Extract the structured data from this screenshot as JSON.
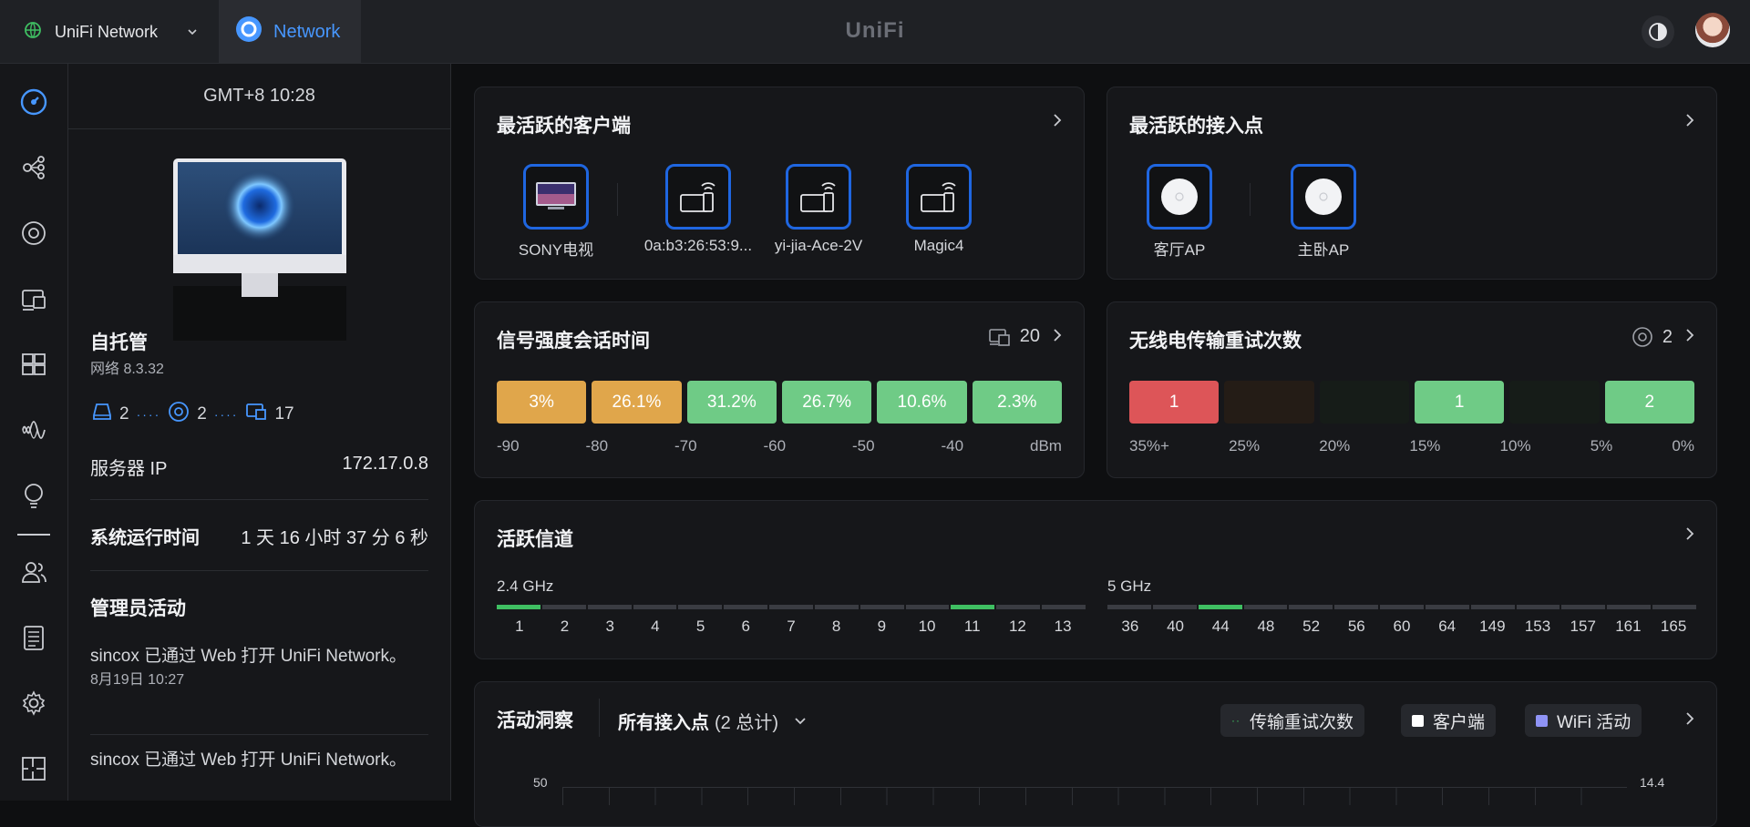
{
  "topbar": {
    "app_name": "UniFi Network",
    "active_tab": "Network",
    "brand": "UniFi"
  },
  "sidebar": {
    "time": "GMT+8 10:28",
    "title": "自托管",
    "version": "网络 8.3.32",
    "counts": {
      "gateways": "2",
      "aps": "2",
      "clients": "17"
    },
    "server_ip_label": "服务器 IP",
    "server_ip": "172.17.0.8",
    "uptime_label": "系统运行时间",
    "uptime": "1 天 16 小时 37 分 6 秒",
    "admin_title": "管理员活动",
    "activities": [
      {
        "text": "sincox 已通过 Web 打开 UniFi Network。",
        "time": "8月19日 10:27"
      },
      {
        "text": "sincox 已通过 Web 打开 UniFi Network。",
        "time": ""
      }
    ]
  },
  "top_clients": {
    "title": "最活跃的客户端",
    "items": [
      {
        "label": "SONY电视",
        "icon": "tv-icon"
      },
      {
        "label": "0a:b3:26:53:9...",
        "icon": "wifi-device-icon"
      },
      {
        "label": "yi-jia-Ace-2V",
        "icon": "wifi-device-icon"
      },
      {
        "label": "Magic4",
        "icon": "wifi-device-icon"
      }
    ]
  },
  "top_aps": {
    "title": "最活跃的接入点",
    "items": [
      {
        "label": "客厅AP",
        "icon": "access-point-icon"
      },
      {
        "label": "主卧AP",
        "icon": "access-point-icon"
      }
    ]
  },
  "signal": {
    "title": "信号强度会话时间",
    "count": "20",
    "segments": [
      {
        "value": "3%",
        "color": "#e0a64b"
      },
      {
        "value": "26.1%",
        "color": "#e0a64b"
      },
      {
        "value": "31.2%",
        "color": "#6fcb86"
      },
      {
        "value": "26.7%",
        "color": "#6fcb86"
      },
      {
        "value": "10.6%",
        "color": "#6fcb86"
      },
      {
        "value": "2.3%",
        "color": "#6fcb86"
      }
    ],
    "labels": [
      "-90",
      "-80",
      "-70",
      "-60",
      "-50",
      "-40",
      "dBm"
    ]
  },
  "retries": {
    "title": "无线电传输重试次数",
    "count": "2",
    "segments": [
      {
        "value": "1",
        "color": "#dd5558"
      },
      {
        "value": "",
        "color": "#241c16"
      },
      {
        "value": "",
        "color": "#161c18"
      },
      {
        "value": "1",
        "color": "#6fcb86"
      },
      {
        "value": "",
        "color": "#161c18"
      },
      {
        "value": "2",
        "color": "#6fcb86"
      }
    ],
    "labels": [
      "35%+",
      "25%",
      "20%",
      "15%",
      "10%",
      "5%",
      "0%"
    ]
  },
  "channels": {
    "title": "活跃信道",
    "band24": {
      "label": "2.4 GHz",
      "channels": [
        "1",
        "2",
        "3",
        "4",
        "5",
        "6",
        "7",
        "8",
        "9",
        "10",
        "11",
        "12",
        "13"
      ],
      "active": [
        "1",
        "11"
      ]
    },
    "band5": {
      "label": "5 GHz",
      "channels": [
        "36",
        "40",
        "44",
        "48",
        "52",
        "56",
        "60",
        "64",
        "149",
        "153",
        "157",
        "161",
        "165"
      ],
      "active": [
        "44"
      ]
    }
  },
  "insights": {
    "title": "活动洞察",
    "filter": "所有接入点",
    "filter_count": "(2 总计)",
    "legend": [
      {
        "label": "传输重试次数",
        "color": "#3fbf62"
      },
      {
        "label": "客户端",
        "color": "#ffffff"
      },
      {
        "label": "WiFi 活动",
        "color": "#8f93f5"
      }
    ],
    "y_left_top": "50",
    "y_right_top": "14.4"
  }
}
